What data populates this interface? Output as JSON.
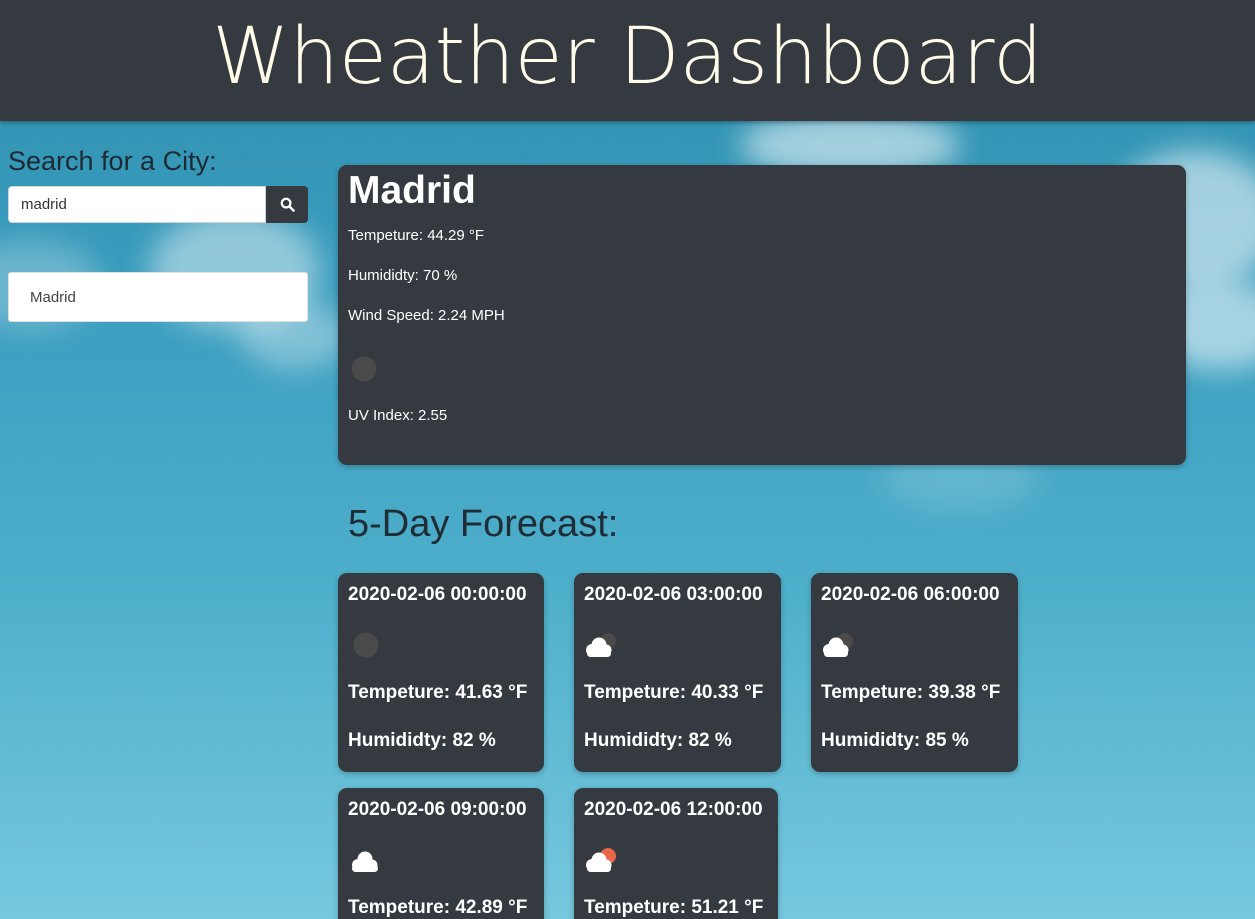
{
  "header": {
    "title": "Wheather Dashboard"
  },
  "sidebar": {
    "search_label": "Search for a City:",
    "search_value": "madrid",
    "search_icon": "search-icon",
    "history": [
      {
        "label": "Madrid"
      }
    ]
  },
  "current": {
    "city": "Madrid",
    "temperature": "Tempeture: 44.29 °F",
    "humidity": "Humididty: 70 %",
    "wind": "Wind Speed: 2.24 MPH",
    "icon": "night-clear-icon",
    "uv": "UV Index:  2.55"
  },
  "forecast": {
    "title": "5-Day Forecast:",
    "days": [
      {
        "date": "2020-02-06 00:00:00",
        "icon": "night-clear-icon",
        "temp": "Tempeture: 41.63 °F",
        "humidity": "Humididty: 82 %"
      },
      {
        "date": "2020-02-06 03:00:00",
        "icon": "night-cloud-icon",
        "temp": "Tempeture: 40.33 °F",
        "humidity": "Humididty: 82 %"
      },
      {
        "date": "2020-02-06 06:00:00",
        "icon": "night-cloud-icon",
        "temp": "Tempeture: 39.38 °F",
        "humidity": "Humididty: 85 %"
      },
      {
        "date": "2020-02-06 09:00:00",
        "icon": "cloud-icon",
        "temp": "Tempeture: 42.89 °F",
        "humidity": ""
      },
      {
        "date": "2020-02-06 12:00:00",
        "icon": "day-cloud-icon",
        "temp": "Tempeture: 51.21 °F",
        "humidity": ""
      }
    ]
  },
  "colors": {
    "header_bg": "#343a40",
    "card_bg": "#343a40",
    "title_text": "#fffbe9",
    "sun_orange": "#e8664a"
  }
}
